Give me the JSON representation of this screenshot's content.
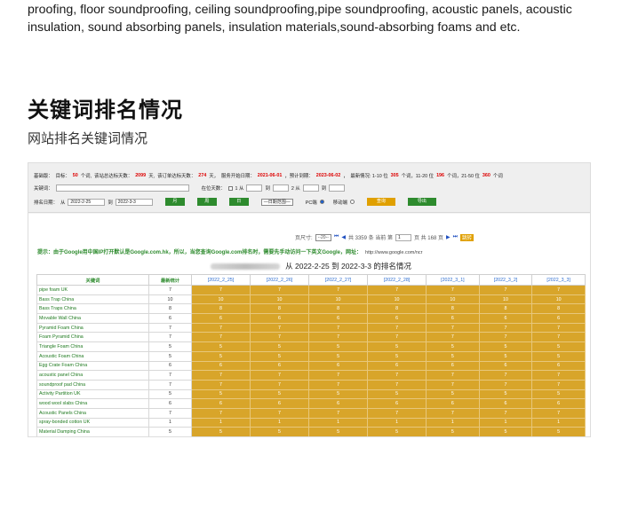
{
  "intro_text": "proofing, floor soundproofing, ceiling soundproofing,pipe soundproofing, acoustic panels, acoustic insulation, sound absorbing panels, insulation materials,sound-absorbing foams and etc.",
  "section": {
    "title": "关键词排名情况",
    "subtitle": "网站排名关键词情况"
  },
  "filter": {
    "basic_label": "基础版：",
    "target_label": "目标：",
    "target_count": "50",
    "target_unit": "个词,",
    "total_days_label": "该站总达标天数：",
    "total_days": "2099",
    "total_days_unit": "天,",
    "consumed_label": "该订单达标天数：",
    "consumed_days": "274",
    "consumed_unit": "天，",
    "start_label": "服务开始日期：",
    "start_date": "2021-06-01",
    "expire_label": "，预计到期：",
    "expire_date": "2023-06-02",
    "rank_label": "，　最新情况: 1-10 位",
    "rank_1_10": "305",
    "rank_11_20_label": "个词，11-20 位",
    "rank_11_20": "196",
    "rank_21_50_label": "个词，21-50 位",
    "rank_21_50": "360",
    "rank_tail": "个词",
    "keyword_label": "关键词：",
    "days_label": "在位天数：",
    "from1": "1 从",
    "to1": "到",
    "from2": "2 从",
    "to2": "到",
    "date_label": "排名日期：",
    "from_label": "从",
    "date_from": "2022-2-25",
    "to_label": "到",
    "date_to": "2022-3-3",
    "btn_month": "月",
    "btn_week": "周",
    "btn_day": "日",
    "engine_select": "—日期范围—",
    "pc_label": "PC端",
    "mobile_label": "移动端",
    "btn_query": "查询",
    "btn_export": "导出"
  },
  "pager": {
    "page_size_label": "页尺寸:",
    "page_size": "--20--",
    "total_text": "共 3359 条 当前 第",
    "page": "1",
    "pages_text": "页 共 168 页",
    "go": "跳转"
  },
  "notice": {
    "text": "提示：由于Google用中国IP打开默认是Google.com.hk，所以，当您查询Google.com排名时，需要先手动访问一下英文Google，网址：",
    "url": "http://www.google.com/ncr"
  },
  "table": {
    "caption": "从 2022-2-25 到 2022-3-3 的排名情况",
    "col_keyword": "关键词",
    "col_stat": "最新统计",
    "dates": [
      "[2022_2_25]",
      "[2022_2_26]",
      "[2022_2_27]",
      "[2022_2_28]",
      "[2022_3_1]",
      "[2022_3_2]",
      "[2022_3_3]"
    ],
    "rows": [
      {
        "kw": "pipe foam UK",
        "stat": "7",
        "ranks": [
          "7",
          "7",
          "7",
          "7",
          "7",
          "7",
          "7"
        ]
      },
      {
        "kw": "Bass Trap China",
        "stat": "10",
        "ranks": [
          "10",
          "10",
          "10",
          "10",
          "10",
          "10",
          "10"
        ]
      },
      {
        "kw": "Bass Traps China",
        "stat": "8",
        "ranks": [
          "8",
          "8",
          "8",
          "8",
          "8",
          "8",
          "8"
        ]
      },
      {
        "kw": "Movable Wall China",
        "stat": "6",
        "ranks": [
          "6",
          "6",
          "6",
          "6",
          "6",
          "6",
          "6"
        ]
      },
      {
        "kw": "Pyramid Foam China",
        "stat": "7",
        "ranks": [
          "7",
          "7",
          "7",
          "7",
          "7",
          "7",
          "7"
        ]
      },
      {
        "kw": "Foam Pyramid China",
        "stat": "7",
        "ranks": [
          "7",
          "7",
          "7",
          "7",
          "7",
          "7",
          "7"
        ]
      },
      {
        "kw": "Triangle Foam China",
        "stat": "5",
        "ranks": [
          "5",
          "5",
          "5",
          "5",
          "5",
          "5",
          "5"
        ]
      },
      {
        "kw": "Acoustic Foam China",
        "stat": "5",
        "ranks": [
          "5",
          "5",
          "5",
          "5",
          "5",
          "5",
          "5"
        ]
      },
      {
        "kw": "Egg Crate Foam China",
        "stat": "6",
        "ranks": [
          "6",
          "6",
          "6",
          "6",
          "6",
          "6",
          "6"
        ]
      },
      {
        "kw": "acoustic panel China",
        "stat": "7",
        "ranks": [
          "7",
          "7",
          "7",
          "7",
          "7",
          "7",
          "7"
        ]
      },
      {
        "kw": "soundproof pad China",
        "stat": "7",
        "ranks": [
          "7",
          "7",
          "7",
          "7",
          "7",
          "7",
          "7"
        ]
      },
      {
        "kw": "Activity Partition UK",
        "stat": "5",
        "ranks": [
          "5",
          "5",
          "5",
          "5",
          "5",
          "5",
          "5"
        ]
      },
      {
        "kw": "wood wool slabs China",
        "stat": "6",
        "ranks": [
          "6",
          "6",
          "6",
          "6",
          "6",
          "6",
          "6"
        ]
      },
      {
        "kw": "Acoustic Panels China",
        "stat": "7",
        "ranks": [
          "7",
          "7",
          "7",
          "7",
          "7",
          "7",
          "7"
        ]
      },
      {
        "kw": "spray-bonded cotton UK",
        "stat": "1",
        "ranks": [
          "1",
          "1",
          "1",
          "1",
          "1",
          "1",
          "1"
        ]
      },
      {
        "kw": "Material Damping China",
        "stat": "5",
        "ranks": [
          "5",
          "5",
          "5",
          "5",
          "5",
          "5",
          "5"
        ]
      }
    ]
  }
}
